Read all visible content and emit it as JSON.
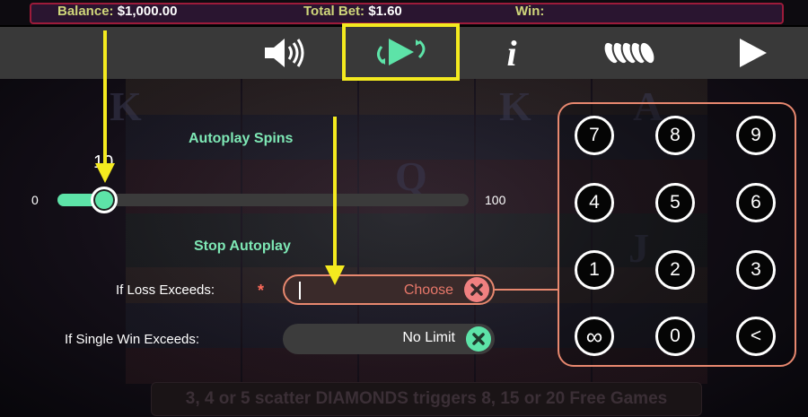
{
  "info_bar": {
    "balance_label": "Balance:",
    "balance_value": "$1,000.00",
    "total_bet_label": "Total Bet:",
    "total_bet_value": "$1.60",
    "win_label": "Win:",
    "win_value": ""
  },
  "menu": {
    "items": [
      {
        "icon": "speaker-icon",
        "active": false
      },
      {
        "icon": "autoplay-icon",
        "active": true
      },
      {
        "icon": "info-icon",
        "active": false
      },
      {
        "icon": "coins-icon",
        "active": false
      },
      {
        "icon": "play-icon",
        "active": false
      }
    ],
    "info_glyph": "i"
  },
  "autoplay": {
    "title": "Autoplay Spins",
    "slider": {
      "min": "0",
      "max": "100",
      "value": "10",
      "level": 10
    }
  },
  "stop_autoplay": {
    "title": "Stop Autoplay",
    "loss_label": "If Loss Exceeds:",
    "required_mark": "*",
    "loss_value": "Choose",
    "single_win_label": "If Single Win Exceeds:",
    "single_win_value": "No Limit"
  },
  "keypad": {
    "keys": [
      "7",
      "8",
      "9",
      "4",
      "5",
      "6",
      "1",
      "2",
      "3",
      "∞",
      "0",
      "<"
    ]
  },
  "background": {
    "scatter_text": "3, 4 or 5 scatter DIAMONDS triggers 8, 15 or 20 Free Games"
  },
  "colors": {
    "accent": "#5de3a8",
    "highlight": "#f4ea1f",
    "error": "#e8886f",
    "info_text": "#cfd67a"
  }
}
